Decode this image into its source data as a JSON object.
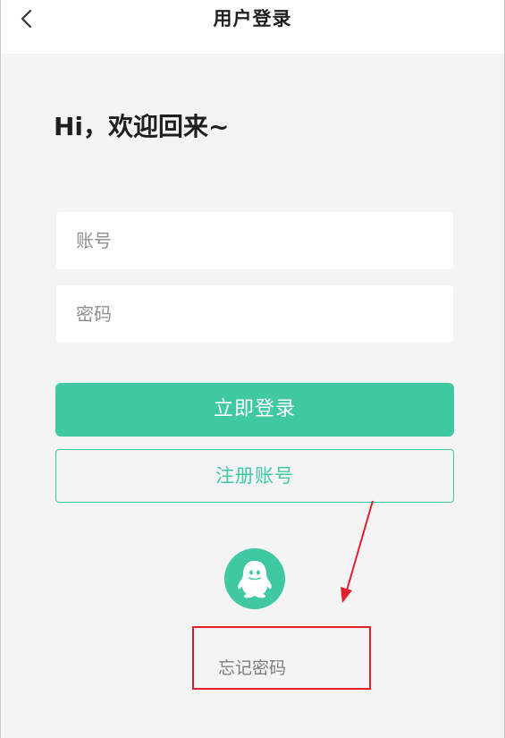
{
  "header": {
    "title": "用户登录",
    "back_icon": "chevron-left-icon"
  },
  "greeting": "Hi，欢迎回来~",
  "form": {
    "account_placeholder": "账号",
    "password_placeholder": "密码",
    "login_label": "立即登录",
    "register_label": "注册账号"
  },
  "social": {
    "qq_icon": "qq-penguin-icon"
  },
  "forgot_password_label": "忘记密码",
  "colors": {
    "accent": "#40c8a2",
    "background": "#f4f4f4",
    "annotation": "#e0212b"
  }
}
